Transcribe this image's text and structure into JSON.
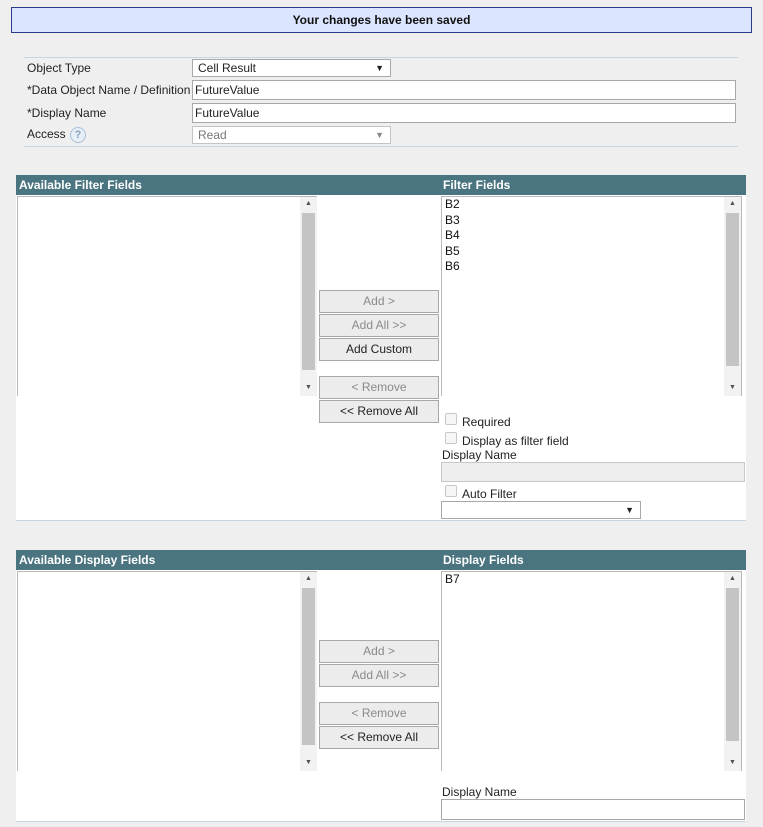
{
  "banner": {
    "message": "Your changes have been saved"
  },
  "form": {
    "object_type": {
      "label": "Object Type",
      "value": "Cell Result"
    },
    "definition": {
      "label": "*Data Object Name / Definition",
      "value": "FutureValue"
    },
    "display_name": {
      "label": "*Display Name",
      "value": "FutureValue"
    },
    "access": {
      "label": "Access",
      "value": "Read",
      "help_glyph": "?"
    }
  },
  "filter_panel": {
    "available_header": "Available Filter Fields",
    "selected_header": "Filter Fields",
    "available_items": [],
    "selected_items": [
      "B2",
      "B3",
      "B4",
      "B5",
      "B6"
    ],
    "buttons": {
      "add": "Add >",
      "add_all": "Add All >>",
      "add_custom": "Add Custom",
      "remove": "< Remove",
      "remove_all": "<< Remove All"
    },
    "options": {
      "required_label": "Required",
      "display_as_filter_label": "Display as filter field",
      "display_name_label": "Display Name",
      "display_name_value": "",
      "auto_filter_label": "Auto Filter",
      "auto_filter_value": ""
    }
  },
  "display_panel": {
    "available_header": "Available Display Fields",
    "selected_header": "Display Fields",
    "available_items": [],
    "selected_items": [
      "B7"
    ],
    "buttons": {
      "add": "Add >",
      "add_all": "Add All >>",
      "remove": "< Remove",
      "remove_all": "<< Remove All"
    },
    "display_name_label": "Display Name",
    "display_name_value": ""
  },
  "icons": {
    "dropdown_arrow": "▼",
    "scroll_up": "▲",
    "scroll_down": "▼"
  },
  "colors": {
    "panel_header": "#4a7480",
    "banner_bg": "#dbe5ff",
    "banner_border": "#2e3a8c"
  }
}
